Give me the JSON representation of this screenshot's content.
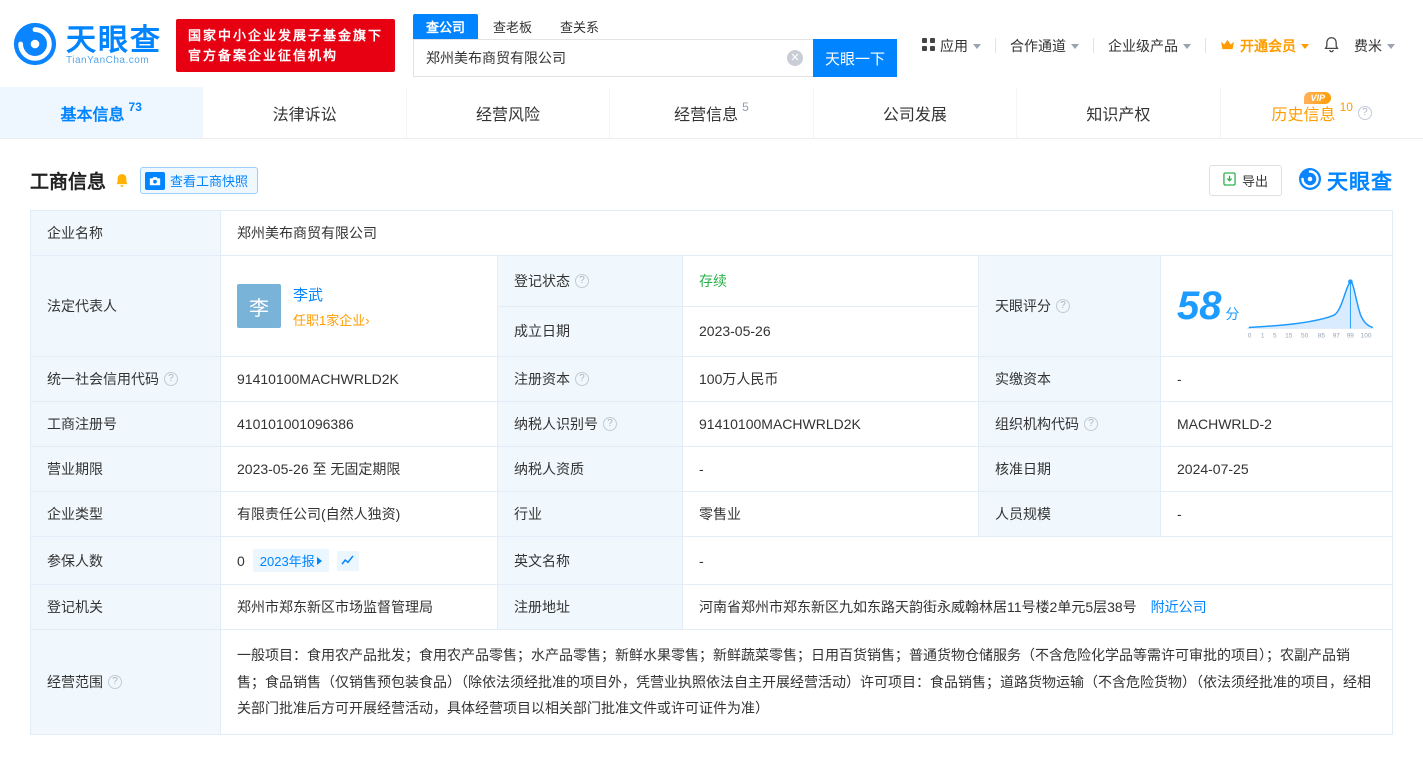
{
  "colors": {
    "accent": "#0084ff",
    "orange": "#ff9d00",
    "red": "#e60012",
    "green": "#28b24b"
  },
  "header": {
    "logo_title": "天眼查",
    "logo_sub": "TianYanCha.com",
    "badge_line1": "国家中小企业发展子基金旗下",
    "badge_line2": "官方备案企业征信机构",
    "search_tabs": [
      {
        "label": "查公司"
      },
      {
        "label": "查老板"
      },
      {
        "label": "查关系"
      }
    ],
    "search_value": "郑州美布商贸有限公司",
    "search_button": "天眼一下",
    "menu_app": "应用",
    "menu_coop": "合作通道",
    "menu_enterprise": "企业级产品",
    "menu_vip": "开通会员",
    "menu_user": "费米"
  },
  "nav": {
    "tabs": [
      {
        "label": "基本信息",
        "count": "73"
      },
      {
        "label": "法律诉讼",
        "count": ""
      },
      {
        "label": "经营风险",
        "count": ""
      },
      {
        "label": "经营信息",
        "count": "5"
      },
      {
        "label": "公司发展",
        "count": ""
      },
      {
        "label": "知识产权",
        "count": ""
      },
      {
        "label": "历史信息",
        "count": "10",
        "vip": "VIP"
      }
    ]
  },
  "section": {
    "title": "工商信息",
    "snapshot_button": "查看工商快照",
    "export_button": "导出",
    "brand": "天眼查"
  },
  "table": {
    "company_name_label": "企业名称",
    "company_name": "郑州美布商贸有限公司",
    "legal_rep_label": "法定代表人",
    "legal_rep_avatar": "李",
    "legal_rep_name": "李武",
    "legal_rep_link": "任职1家企业›",
    "reg_status_label": "登记状态",
    "reg_status": "存续",
    "score_label": "天眼评分",
    "score_value": "58",
    "score_unit": "分",
    "score_axis": [
      "0",
      "1",
      "5",
      "15",
      "50",
      "85",
      "97",
      "99",
      "100"
    ],
    "established_label": "成立日期",
    "established": "2023-05-26",
    "credit_code_label": "统一社会信用代码",
    "credit_code": "91410100MACHWRLD2K",
    "reg_capital_label": "注册资本",
    "reg_capital": "100万人民币",
    "paid_capital_label": "实缴资本",
    "paid_capital": "-",
    "reg_number_label": "工商注册号",
    "reg_number": "410101001096386",
    "taxpayer_id_label": "纳税人识别号",
    "taxpayer_id": "91410100MACHWRLD2K",
    "org_code_label": "组织机构代码",
    "org_code": "MACHWRLD-2",
    "business_term_label": "营业期限",
    "business_term": "2023-05-26 至 无固定期限",
    "taxpayer_quality_label": "纳税人资质",
    "taxpayer_quality": "-",
    "approval_date_label": "核准日期",
    "approval_date": "2024-07-25",
    "company_type_label": "企业类型",
    "company_type": "有限责任公司(自然人独资)",
    "industry_label": "行业",
    "industry": "零售业",
    "staff_size_label": "人员规模",
    "staff_size": "-",
    "insured_label": "参保人数",
    "insured": "0",
    "insured_report_link": "2023年报",
    "english_name_label": "英文名称",
    "english_name": "-",
    "reg_authority_label": "登记机关",
    "reg_authority": "郑州市郑东新区市场监督管理局",
    "reg_address_label": "注册地址",
    "reg_address": "河南省郑州市郑东新区九如东路天韵街永威翰林居11号楼2单元5层38号",
    "nearby_link": "附近公司",
    "business_scope_label": "经营范围",
    "business_scope": "一般项目：食用农产品批发；食用农产品零售；水产品零售；新鲜水果零售；新鲜蔬菜零售；日用百货销售；普通货物仓储服务（不含危险化学品等需许可审批的项目）；农副产品销售；食品销售（仅销售预包装食品）（除依法须经批准的项目外，凭营业执照依法自主开展经营活动）许可项目：食品销售；道路货物运输（不含危险货物）（依法须经批准的项目，经相关部门批准后方可开展经营活动，具体经营项目以相关部门批准文件或许可证件为准）"
  }
}
